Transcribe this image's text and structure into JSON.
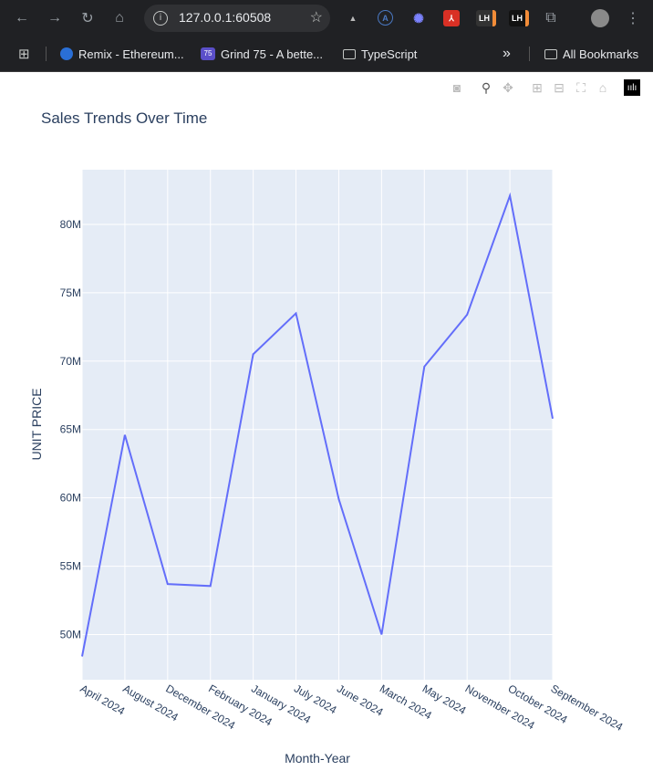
{
  "browser": {
    "url": "127.0.0.1:60508",
    "bookmarks": [
      {
        "label": "Remix - Ethereum...",
        "icon": "remix-icon"
      },
      {
        "label": "Grind 75 - A bette...",
        "icon": "grind75-icon",
        "badge": "75"
      },
      {
        "label": "TypeScript",
        "icon": "folder-icon"
      }
    ],
    "all_bookmarks": "All Bookmarks",
    "overflow": "»"
  },
  "chart_data": {
    "type": "line",
    "title": "Sales Trends Over Time",
    "xlabel": "Month-Year",
    "ylabel": "UNIT PRICE",
    "categories": [
      "April 2024",
      "August 2024",
      "December 2024",
      "February 2024",
      "January 2024",
      "July 2024",
      "June 2024",
      "March 2024",
      "May 2024",
      "November 2024",
      "October 2024",
      "September 2024"
    ],
    "series": [
      {
        "values": [
          48400000,
          64600000,
          53700000,
          53550000,
          70500000,
          73500000,
          59900000,
          50000000,
          69600000,
          73400000,
          82100000,
          65800000
        ]
      }
    ],
    "ylim": [
      46700000,
      84000000
    ],
    "yticks": [
      50000000,
      55000000,
      60000000,
      65000000,
      70000000,
      75000000,
      80000000
    ],
    "ytick_labels": [
      "50M",
      "55M",
      "60M",
      "65M",
      "70M",
      "75M",
      "80M"
    ],
    "line_color": "#636efa",
    "plot_bg": "#e5ecf6",
    "grid": true
  }
}
